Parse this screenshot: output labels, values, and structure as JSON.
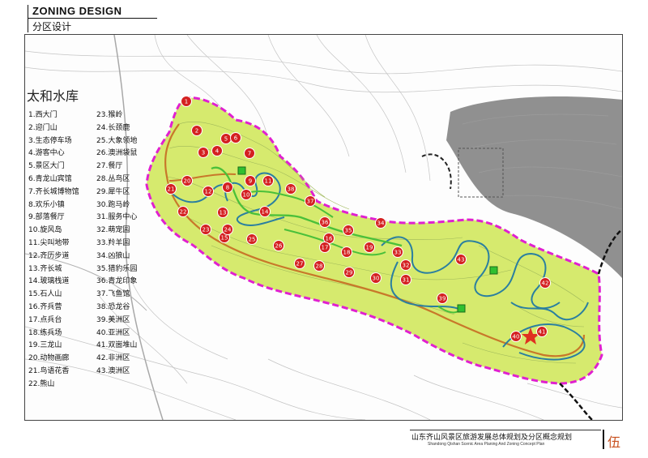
{
  "header": {
    "title_en": "ZONING DESIGN",
    "title_cn": "分区设计"
  },
  "map": {
    "reservoir_label": "太和水库",
    "legend_col1": [
      "1.西大门",
      "2.迎门山",
      "3.生态停车场",
      "4.游客中心",
      "5.景区大门",
      "6.青龙山宾馆",
      "7.齐长城博物馆",
      "8.欢乐小镇",
      "9.部落餐厅",
      "10.旋风岛",
      "11.尖叫地带",
      "12.齐历步道",
      "13.齐长城",
      "14.玻璃栈道",
      "15.石人山",
      "16.齐兵营",
      "17.点兵台",
      "18.练兵场",
      "19.三龙山",
      "20.动物画廊",
      "21.鸟语花香",
      "22.熊山"
    ],
    "legend_col2": [
      "23.猴岭",
      "24.长颈鹿",
      "25.大象领地",
      "26.澳洲袋鼠",
      "27.餐厅",
      "28.丛鸟区",
      "29.犀牛区",
      "30.跑马岭",
      "31.服务中心",
      "32.萌宠园",
      "33.羚羊园",
      "34.凶狼山",
      "35.猎豹乐园",
      "36.青龙印象",
      "37.飞鱼馆",
      "38.恐龙谷",
      "39.美洲区",
      "40.亚洲区",
      "41.双崮堆山",
      "42.非洲区",
      "43.澳洲区"
    ],
    "markers": [
      "1",
      "2",
      "3",
      "4",
      "5",
      "6",
      "7",
      "8",
      "9",
      "10",
      "11",
      "12",
      "13",
      "14",
      "15",
      "16",
      "17",
      "18",
      "19",
      "20",
      "21",
      "22",
      "23",
      "24",
      "25",
      "26",
      "27",
      "28",
      "29",
      "30",
      "31",
      "32",
      "33",
      "34",
      "35",
      "36",
      "37",
      "38",
      "39",
      "40",
      "41",
      "42",
      "43"
    ],
    "colors": {
      "zone_fill": "#d6ea6e",
      "boundary": "#e020d0",
      "marker": "#d42020",
      "road_green": "#4ac03a",
      "road_blue": "#2a7fa0",
      "road_orange": "#c8782a",
      "terrain_dark": "#8a8a8a"
    }
  },
  "footer": {
    "title_cn": "山东齐山风景区旅游发展总体规划及分区概念规划",
    "title_en": "Shandong Qishan Scenic Area Planing And Zoning Concept Plan",
    "page": "伍"
  }
}
